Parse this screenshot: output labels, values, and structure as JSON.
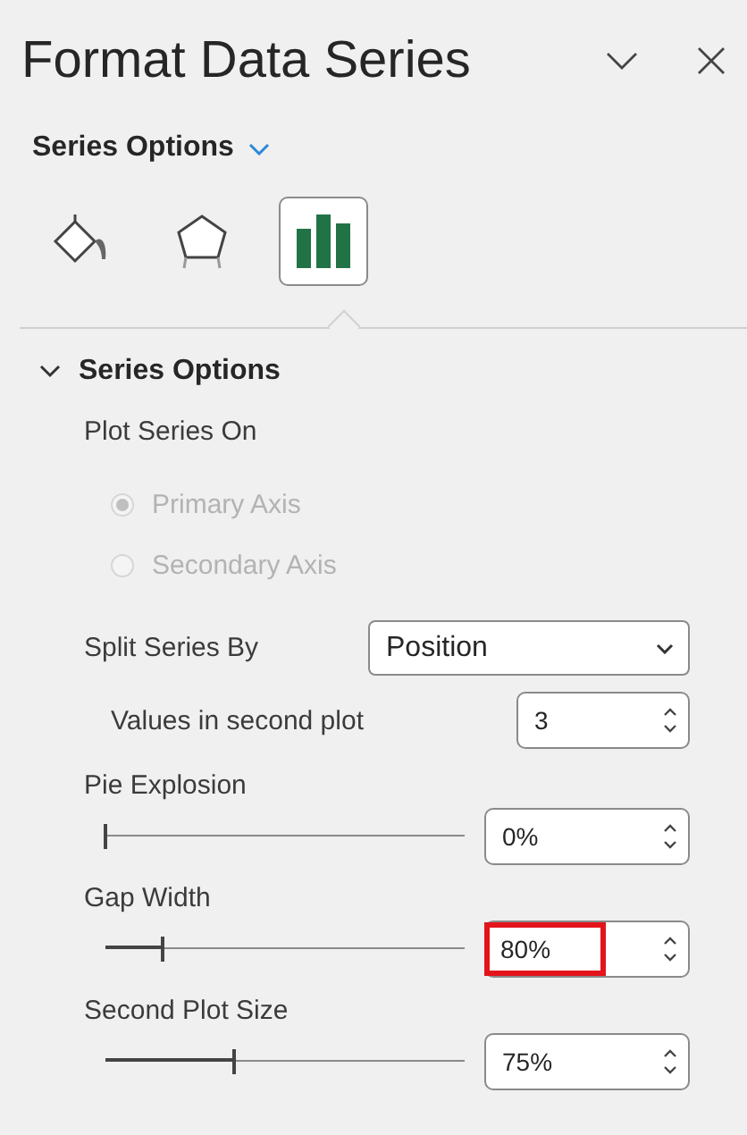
{
  "pane": {
    "title": "Format Data Series"
  },
  "options_menu": {
    "label": "Series Options"
  },
  "category_tabs": [
    {
      "kind": "fill",
      "selected": false
    },
    {
      "kind": "effects",
      "selected": false
    },
    {
      "kind": "series",
      "selected": true
    }
  ],
  "section": {
    "title": "Series Options",
    "expanded": true,
    "plot_series_on": {
      "label": "Plot Series On",
      "disabled": true,
      "options": [
        {
          "label": "Primary Axis",
          "selected": true
        },
        {
          "label": "Secondary Axis",
          "selected": false
        }
      ]
    },
    "split_series_by": {
      "label": "Split Series By",
      "value": "Position"
    },
    "values_in_second_plot": {
      "label": "Values in second plot",
      "value": "3"
    },
    "sliders": [
      {
        "label": "Pie Explosion",
        "level": 0.0,
        "value": "0%",
        "highlighted": false
      },
      {
        "label": "Gap Width",
        "level": 0.16,
        "value": "80%",
        "highlighted": true
      },
      {
        "label": "Second Plot Size",
        "level": 0.36,
        "value": "75%",
        "highlighted": false
      }
    ]
  }
}
